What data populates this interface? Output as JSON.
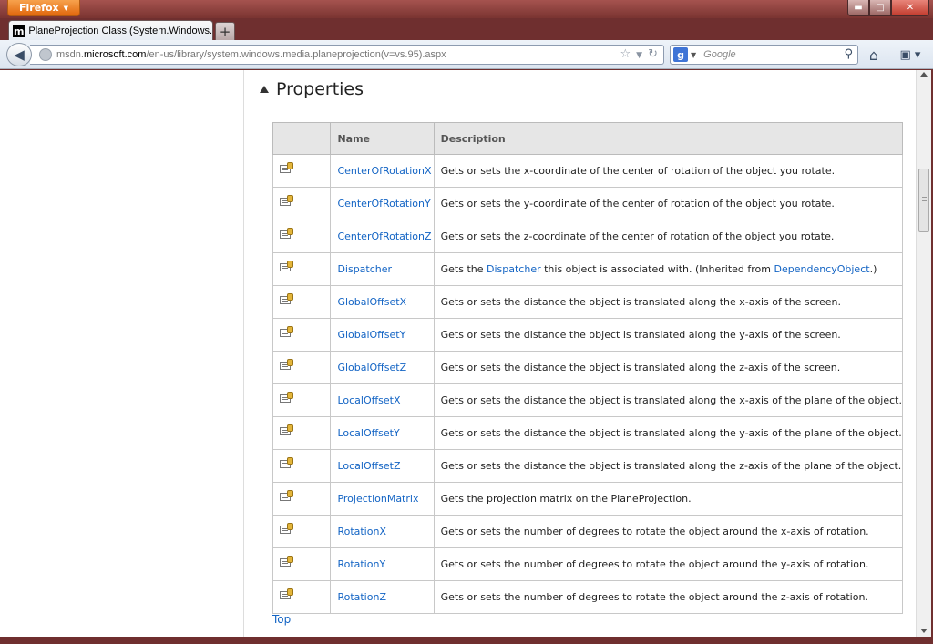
{
  "browser": {
    "app_button_label": "Firefox",
    "tab_title": "PlaneProjection Class (System.Windows....",
    "tab_favicon_letter": "m",
    "new_tab_label": "+",
    "url_prefix": "msdn.",
    "url_domain": "microsoft.com",
    "url_path": "/en-us/library/system.windows.media.planeprojection(v=vs.95).aspx",
    "search_placeholder": "Google",
    "search_engine_letter": "g"
  },
  "section": {
    "title": "Properties",
    "columns": [
      "",
      "Name",
      "Description"
    ],
    "rows": [
      {
        "name": "CenterOfRotationX",
        "description": "Gets or sets the x-coordinate of the center of rotation of the object you rotate."
      },
      {
        "name": "CenterOfRotationY",
        "description": "Gets or sets the y-coordinate of the center of rotation of the object you rotate."
      },
      {
        "name": "CenterOfRotationZ",
        "description": "Gets or sets the z-coordinate of the center of rotation of the object you rotate."
      },
      {
        "name": "Dispatcher",
        "description_parts": [
          "Gets the ",
          "Dispatcher",
          " this object is associated with. (Inherited from ",
          "DependencyObject",
          ".)"
        ]
      },
      {
        "name": "GlobalOffsetX",
        "description": "Gets or sets the distance the object is translated along the x-axis of the screen."
      },
      {
        "name": "GlobalOffsetY",
        "description": "Gets or sets the distance the object is translated along the y-axis of the screen."
      },
      {
        "name": "GlobalOffsetZ",
        "description": "Gets or sets the distance the object is translated along the z-axis of the screen."
      },
      {
        "name": "LocalOffsetX",
        "description": "Gets or sets the distance the object is translated along the x-axis of the plane of the object."
      },
      {
        "name": "LocalOffsetY",
        "description": "Gets or sets the distance the object is translated along the y-axis of the plane of the object."
      },
      {
        "name": "LocalOffsetZ",
        "description": "Gets or sets the distance the object is translated along the z-axis of the plane of the object."
      },
      {
        "name": "ProjectionMatrix",
        "description": "Gets the projection matrix on the PlaneProjection."
      },
      {
        "name": "RotationX",
        "description": "Gets or sets the number of degrees to rotate the object around the x-axis of rotation."
      },
      {
        "name": "RotationY",
        "description": "Gets or sets the number of degrees to rotate the object around the y-axis of rotation."
      },
      {
        "name": "RotationZ",
        "description": "Gets or sets the number of degrees to rotate the object around the z-axis of rotation."
      }
    ],
    "top_link": "Top"
  },
  "colors": {
    "link": "#1364c4",
    "firefox_button": "#e1670d"
  }
}
